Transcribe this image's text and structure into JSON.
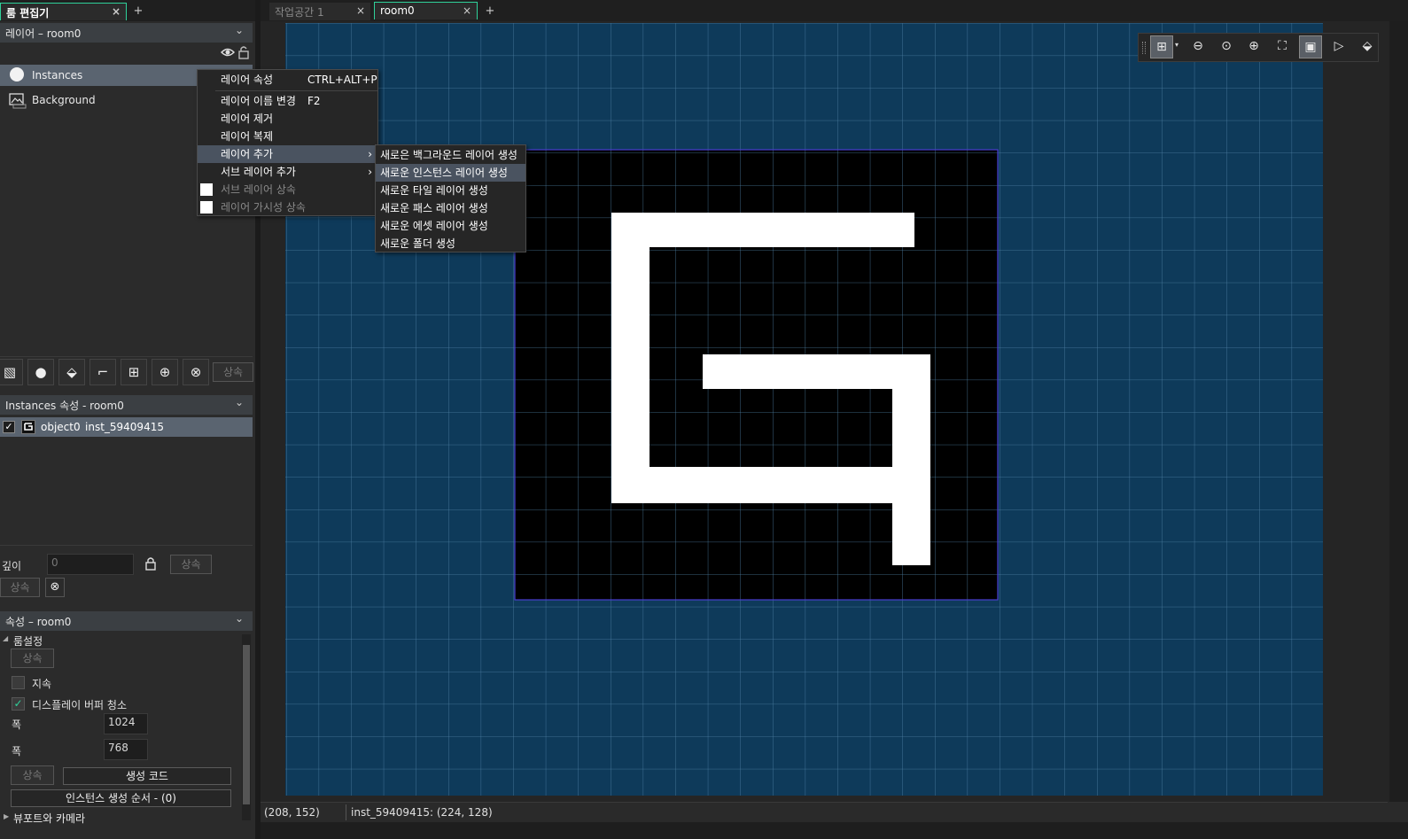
{
  "left_tabs": {
    "active": "룸 편집기",
    "close": "×",
    "add": "+"
  },
  "editor_tabs": [
    {
      "label": "작업공간 1",
      "close": "×"
    },
    {
      "label": "room0",
      "close": "×"
    }
  ],
  "editor_tab_add": "+",
  "layers_panel": {
    "title": "레이어 – room0",
    "layers": [
      {
        "name": "Instances",
        "icon": "instance-layer-icon"
      },
      {
        "name": "Background",
        "icon": "background-layer-icon"
      }
    ],
    "toolbar": [
      {
        "icon": "add-background-layer-icon",
        "glyph": "▧"
      },
      {
        "icon": "add-instance-layer-icon",
        "glyph": "●"
      },
      {
        "icon": "add-asset-layer-icon",
        "glyph": "⬙"
      },
      {
        "icon": "add-path-layer-icon",
        "glyph": "⌐"
      },
      {
        "icon": "add-tile-layer-icon",
        "glyph": "⊞"
      },
      {
        "icon": "add-folder-icon",
        "glyph": "⊕"
      },
      {
        "icon": "delete-layer-icon",
        "glyph": "⊗"
      }
    ],
    "inherit_label": "상속"
  },
  "context_menu": {
    "items": [
      {
        "label": "레이어 속성",
        "shortcut": "CTRL+ALT+P"
      },
      {
        "label": "레이어 이름 변경",
        "shortcut": "F2"
      },
      {
        "label": "레이어 제거",
        "shortcut": ""
      },
      {
        "label": "레이어 복제",
        "shortcut": ""
      },
      {
        "label": "레이어 추가",
        "shortcut": ""
      },
      {
        "label": "서브 레이어 추가",
        "shortcut": ""
      },
      {
        "label": "서브 레이어 상속",
        "shortcut": ""
      },
      {
        "label": "레이어 가시성 상속",
        "shortcut": ""
      }
    ],
    "submenu_arrow": "›"
  },
  "submenu": {
    "items": [
      "새로은 백그라운드 레이어 생성",
      "새로운 인스턴스 레이어 생성",
      "새로운 타일 레이어 생성",
      "새로운 패스 레이어 생성",
      "새로운 에셋 레이어 생성",
      "새로운 폴더 생성"
    ]
  },
  "instances_panel": {
    "title": "Instances 속성 - room0",
    "rows": [
      {
        "object": "object0",
        "instance": "inst_59409415"
      }
    ],
    "depth_label": "깊이",
    "depth_value": "0",
    "inherit_label": "상속"
  },
  "room_props": {
    "title": "속성 – room0",
    "section": "룸설정",
    "inherit_label": "상속",
    "persistent_label": "지속",
    "clear_display_label": "디스플레이 버퍼 청소",
    "width_label": "폭",
    "width_value": "1024",
    "height_label": "폭",
    "height_value": "768",
    "creation_code_label": "생성 코드",
    "instance_order_label": "인스턴스 생성 순서 - (0)",
    "viewport_section": "뷰포트와 카메라"
  },
  "canvas_toolbar": [
    {
      "icon": "grid-toggle-icon",
      "glyph": "⊞"
    },
    {
      "icon": "zoom-out-icon",
      "glyph": "⊖"
    },
    {
      "icon": "zoom-reset-icon",
      "glyph": "⊙"
    },
    {
      "icon": "zoom-in-icon",
      "glyph": "⊕"
    },
    {
      "icon": "fit-view-icon",
      "glyph": "⛶"
    },
    {
      "icon": "room-bounds-icon",
      "glyph": "▣"
    },
    {
      "icon": "play-icon",
      "glyph": "▷"
    },
    {
      "icon": "layers-view-icon",
      "glyph": "⬙"
    }
  ],
  "status_bar": {
    "cursor": "(208, 152)",
    "instance_info": "inst_59409415: (224, 128)"
  },
  "colors": {
    "room_bg": "#0e3a5a",
    "grid_line": "#4d7fa3",
    "sprite_bg": "#000000",
    "sprite_fg": "#ffffff",
    "active_tab": "#2fd19a",
    "menu_highlight": "#4a5360"
  }
}
